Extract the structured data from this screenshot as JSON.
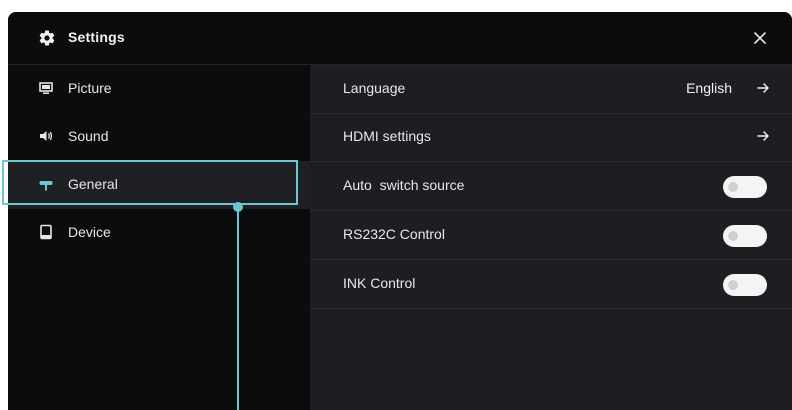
{
  "window": {
    "title": "Settings",
    "title_icon": "gear-icon",
    "close_icon": "close-icon"
  },
  "sidebar": {
    "items": [
      {
        "label": "Picture",
        "icon": "monitor-icon"
      },
      {
        "label": "Sound",
        "icon": "speaker-icon"
      },
      {
        "label": "General",
        "icon": "pin-icon",
        "selected": true
      },
      {
        "label": "Device",
        "icon": "tablet-icon"
      }
    ]
  },
  "settings": {
    "rows": [
      {
        "label": "Language",
        "value": "English",
        "control": "arrow"
      },
      {
        "label": "HDMI settings",
        "control": "arrow"
      },
      {
        "label": "Auto  switch source",
        "control": "toggle",
        "on": false
      },
      {
        "label": "RS232C Control",
        "control": "toggle",
        "on": false
      },
      {
        "label": "INK Control",
        "control": "toggle",
        "on": false
      }
    ]
  },
  "colors": {
    "window_bg": "#0b0c0e",
    "content_bg": "#1d1e21",
    "focus_accent": "#6fc6d2",
    "toggle_track": "#f4f4f4"
  }
}
